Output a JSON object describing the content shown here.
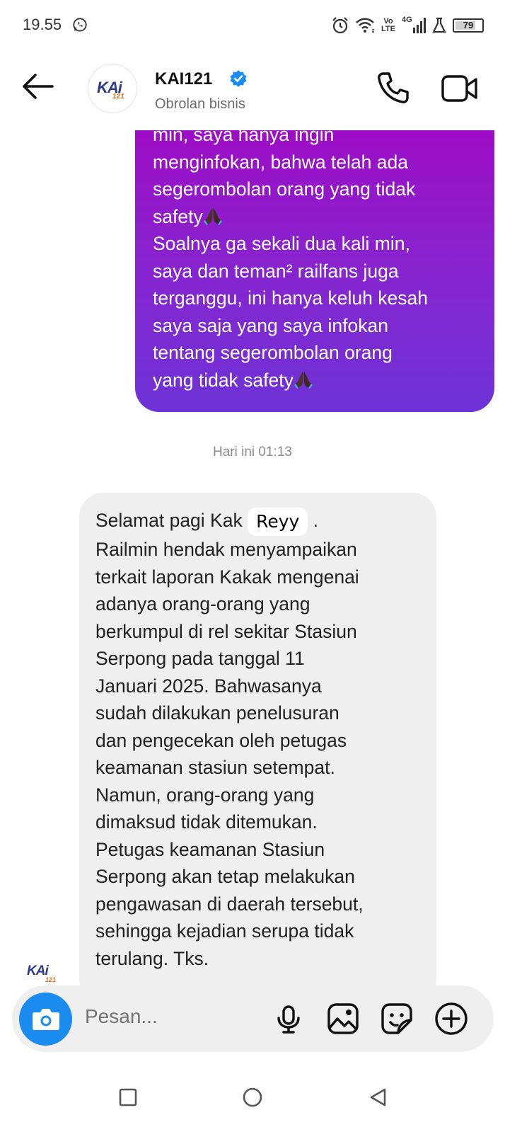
{
  "status_bar": {
    "time": "19.55",
    "network_label": "4G",
    "volte_label": "Vo LTE",
    "battery": "79",
    "battery_level": 0.79,
    "icons": [
      "whatsapp-icon",
      "alarm-icon",
      "wifi-icon",
      "volte-icon",
      "signal-icon",
      "lab-icon",
      "battery-icon"
    ]
  },
  "header": {
    "contact_name": "KAI121",
    "contact_subtitle": "Obrolan bisnis",
    "avatar_logo_main": "KAi",
    "avatar_logo_sub": "121",
    "icons": [
      "back-arrow-icon",
      "verified-badge-icon",
      "phone-icon",
      "video-camera-icon"
    ]
  },
  "messages": {
    "outgoing": {
      "lines": [
        "min, saya hanya ingin",
        "menginfokan, bahwa telah ada",
        "segerombolan orang yang tidak",
        "safety",
        "Soalnya ga sekali dua kali min,",
        "saya dan teman² railfans juga",
        "terganggu, ini hanya keluh kesah",
        "saya saja yang saya infokan",
        "tentang segerombolan orang",
        "yang tidak safety"
      ],
      "emoji": "folded-hands-icon"
    },
    "timestamp": "Hari ini 01:13",
    "incoming": {
      "greeting_prefix": "Selamat pagi Kak ",
      "name": "Reyy",
      "greeting_suffix": " .",
      "lines": [
        "Railmin hendak menyampaikan",
        "terkait laporan Kakak mengenai",
        "adanya orang-orang yang",
        "berkumpul di rel sekitar Stasiun",
        "Serpong pada tanggal 11",
        "Januari 2025. Bahwasanya",
        "sudah dilakukan penelusuran",
        "dan pengecekan oleh petugas",
        "keamanan stasiun setempat.",
        "Namun, orang-orang yang",
        "dimaksud tidak ditemukan.",
        "Petugas keamanan Stasiun",
        "Serpong akan tetap melakukan",
        "pengawasan di daerah tersebut,",
        "sehingga kejadian serupa tidak",
        "terulang. Tks."
      ]
    }
  },
  "composer": {
    "placeholder": "Pesan...",
    "icons": [
      "camera-icon",
      "microphone-icon",
      "gallery-icon",
      "sticker-icon",
      "plus-icon"
    ]
  },
  "nav_bar": {
    "icons": [
      "recents-square-icon",
      "home-circle-icon",
      "back-triangle-icon"
    ]
  },
  "colors": {
    "outgoing_gradient_top": "#a10ac4",
    "outgoing_gradient_bottom": "#6d33d6",
    "incoming_bubble": "#efefef",
    "camera_button": "#1a8cf0",
    "verified_badge": "#1a8cf0",
    "logo_blue": "#2b3a8c",
    "logo_orange": "#e06c1a"
  }
}
